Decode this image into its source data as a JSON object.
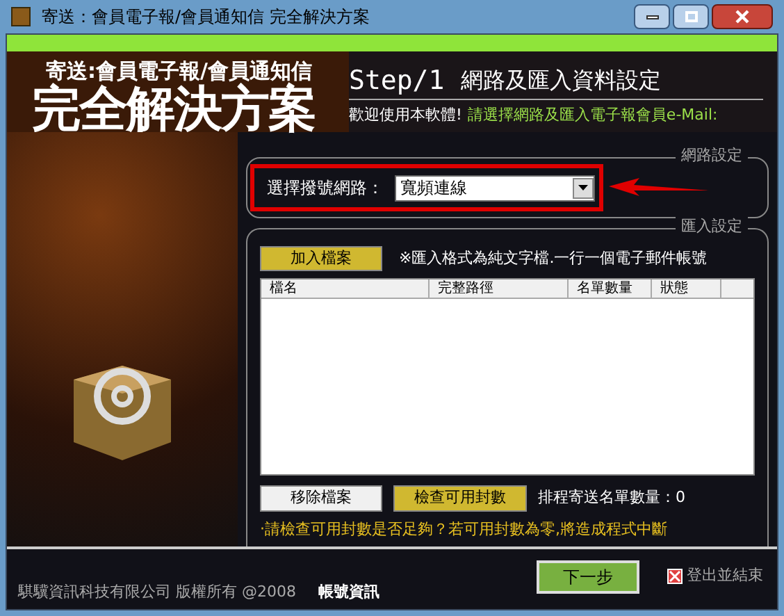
{
  "window": {
    "title": "寄送：會員電子報/會員通知信 完全解決方案"
  },
  "banner": {
    "subtitle": "寄送:會員電子報/會員通知信",
    "title": "完全解決方案"
  },
  "header": {
    "step": "Step/1",
    "heading": "網路及匯入資料設定",
    "welcome": "歡迎使用本軟體!",
    "instruction": "請選擇網路及匯入電子報會員e-Mail:"
  },
  "network": {
    "legend": "網路設定",
    "label": "選擇撥號網路：",
    "value": "寬頻連線"
  },
  "import": {
    "legend": "匯入設定",
    "add_button": "加入檔案",
    "note": "※匯入格式為純文字檔.一行一個電子郵件帳號",
    "columns": [
      "檔名",
      "完整路徑",
      "名單數量",
      "狀態"
    ],
    "remove_button": "移除檔案",
    "check_button": "檢查可用封數",
    "count": "排程寄送名單數量：0",
    "warning": "‧請檢查可用封數是否足夠？若可用封數為零,將造成程式中斷"
  },
  "footer": {
    "copyright": "騏驥資訊科技有限公司 版權所有 @2008",
    "account_link": "帳號資訊",
    "next_button": "下一步",
    "exit_button": "登出並結束"
  }
}
